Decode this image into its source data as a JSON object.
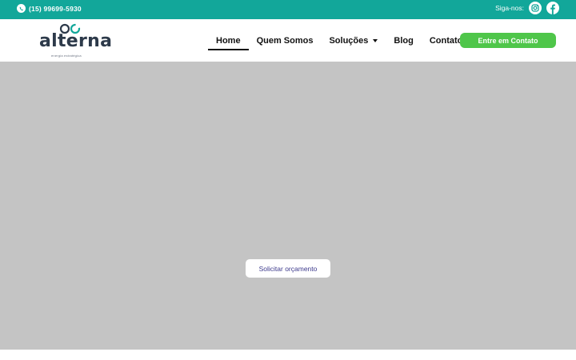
{
  "topbar": {
    "phone": "(15) 99699-5930",
    "social_label": "Siga-nos:",
    "icons": [
      "whatsapp-icon",
      "instagram-icon",
      "facebook-icon"
    ],
    "background": "#12a79a"
  },
  "header": {
    "logo": {
      "word": "alterna",
      "tagline": "energia estratégica"
    },
    "nav": [
      {
        "label": "Home",
        "active": true
      },
      {
        "label": "Quem Somos"
      },
      {
        "label": "Soluções",
        "has_dropdown": true
      },
      {
        "label": "Blog"
      },
      {
        "label": "Contato"
      }
    ],
    "cta_label": "Entre em Contato",
    "cta_color": "#4fc64a"
  },
  "hero": {
    "background": "#c4c4c4",
    "button_label": "Solicitar orçamento",
    "button_text_color": "#3d3a8c"
  }
}
